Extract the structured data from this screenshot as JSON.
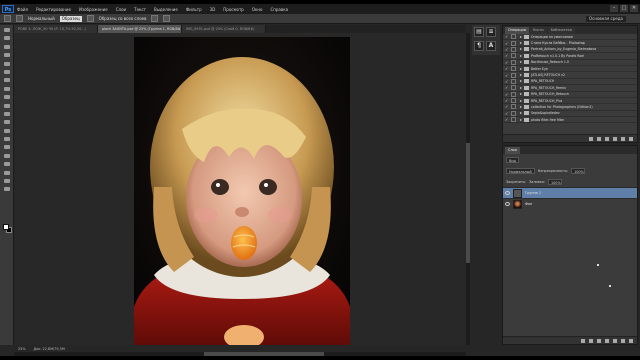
{
  "menu": {
    "logo": "Ps",
    "items": [
      "Файл",
      "Редактирование",
      "Изображение",
      "Слои",
      "Текст",
      "Выделение",
      "Фильтр",
      "3D",
      "Просмотр",
      "Окно",
      "Справка"
    ],
    "window_buttons": [
      "–",
      "□",
      "✕"
    ]
  },
  "options_bar": {
    "mode_label": "Нормальный",
    "field_value": "Образец",
    "checkbox_label": "Образец со всех слоев",
    "workspace": "Основная среда"
  },
  "tabs": [
    {
      "label": "РОВЕ 3: ЛОЖ_90 Ч0 (Р. 10,7% 92,50...)",
      "active": false
    },
    {
      "label": "ploch ЗАЛИТА.psd @ 25% (Группа 1, RGB/8#)",
      "active": true
    },
    {
      "label": "IMG_8951.psd @ 25% (Слой 0, RGB/8#)",
      "active": false
    }
  ],
  "status": {
    "zoom": "25%",
    "doc_size": "Док: 22,8M/79,3M"
  },
  "actions_panel": {
    "tabs": [
      "Операции",
      "Кисти",
      "Библиотеки"
    ],
    "rows": [
      {
        "check": "✓",
        "label": "Операции по умолчанию"
      },
      {
        "check": "✓",
        "label": "Стили Кукла Бейбик - Photoshop"
      },
      {
        "check": "✓",
        "label": "Portrait_Actions_by_Eugenia_Stelmakova"
      },
      {
        "check": "✓",
        "label": "ProRetouch v1.0.1 By Parafo Roel"
      },
      {
        "check": "✓",
        "label": "Nordhouse_Retouch 1.0"
      },
      {
        "check": "✓",
        "label": "Better Eye"
      },
      {
        "check": "✓",
        "label": "[ATLAS] RETOUCH v2"
      },
      {
        "check": "✓",
        "label": "RPA_RETOUCH"
      },
      {
        "check": "✓",
        "label": "RPA_RETOUCH_Remix"
      },
      {
        "check": "✓",
        "label": "RPA_RETOUCH_Retouch"
      },
      {
        "check": "✓",
        "label": "RPA_RETOUCH_Plus"
      },
      {
        "check": "✓",
        "label": "collection for Photographers (Edition2)"
      },
      {
        "check": "✓",
        "label": "Sepia&spindledev"
      },
      {
        "check": "✓",
        "label": "photo filter-free filter"
      }
    ]
  },
  "layers_panel": {
    "tabs": [
      "Слои"
    ],
    "kind_label": "Вид",
    "blend_mode": "Нормальный",
    "opacity_label": "Непрозрачность:",
    "opacity_value": "100%",
    "lock_label": "Закрепить:",
    "fill_label": "Заливка:",
    "fill_value": "100%",
    "layers": [
      {
        "name": "Группа 1",
        "selected": true
      },
      {
        "name": "Фон",
        "selected": false
      }
    ]
  }
}
